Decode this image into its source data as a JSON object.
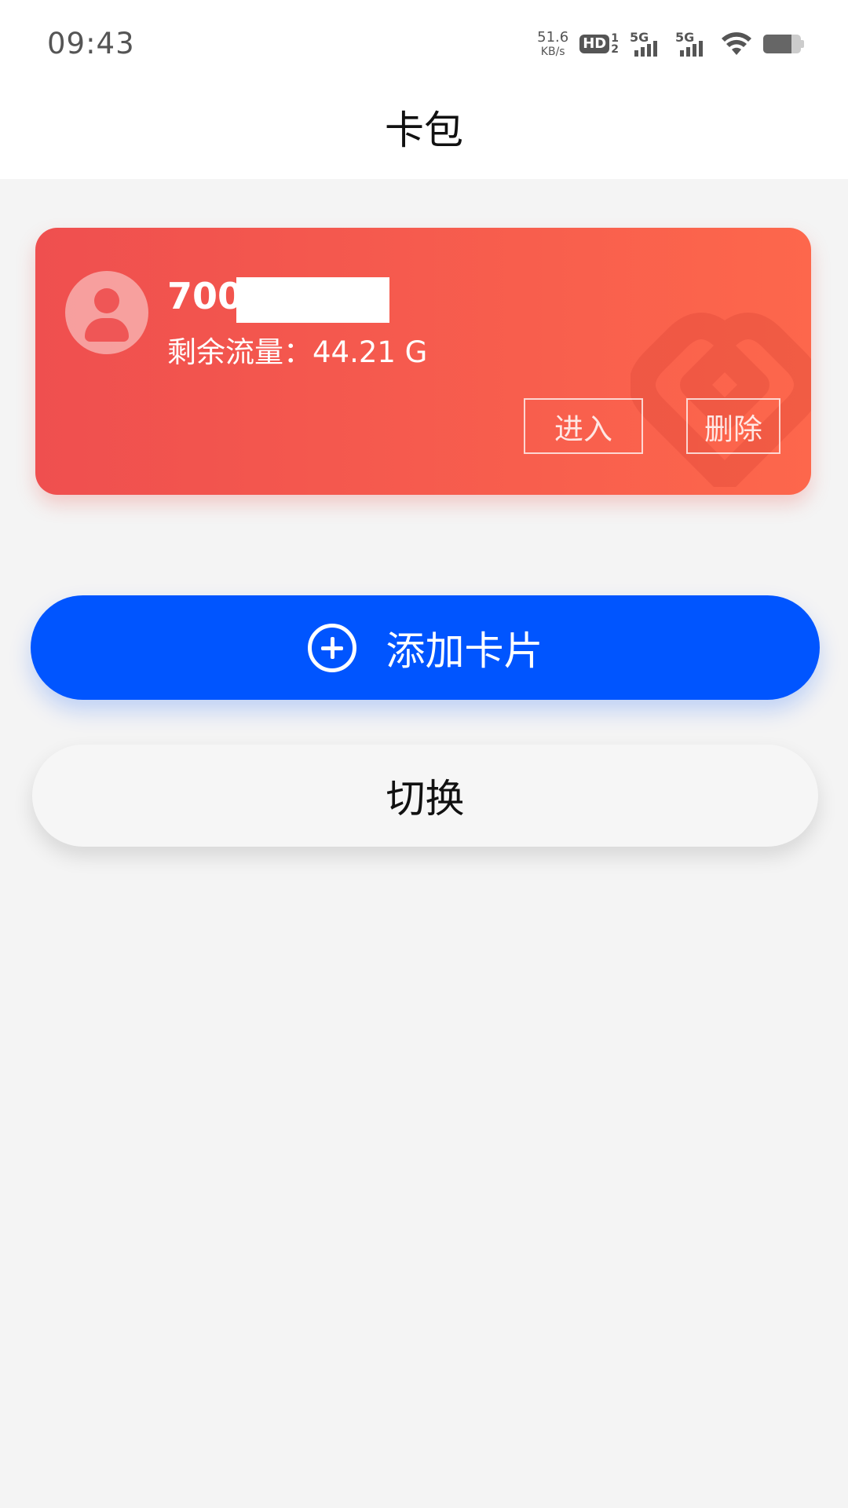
{
  "status_bar": {
    "time": "09:43",
    "net_speed_value": "51.6",
    "net_speed_unit": "KB/s",
    "hd_label": "HD",
    "hd_sim_top": "1",
    "hd_sim_bottom": "2",
    "sim1_type": "5G",
    "sim2_type": "5G",
    "battery_level": 0.75,
    "icons": [
      "hd-icon",
      "signal-icon",
      "signal-icon",
      "wifi-icon",
      "battery-icon"
    ]
  },
  "header": {
    "title": "卡包"
  },
  "card": {
    "number_prefix": "7003",
    "data_label": "剩余流量：",
    "data_value": "44.21 G",
    "enter_label": "进入",
    "delete_label": "删除",
    "colors": {
      "gradient_start": "#ef4f4f",
      "gradient_end": "#fd674c"
    }
  },
  "actions": {
    "add_card_label": "添加卡片",
    "switch_label": "切换",
    "colors": {
      "primary": "#0055ff"
    }
  }
}
